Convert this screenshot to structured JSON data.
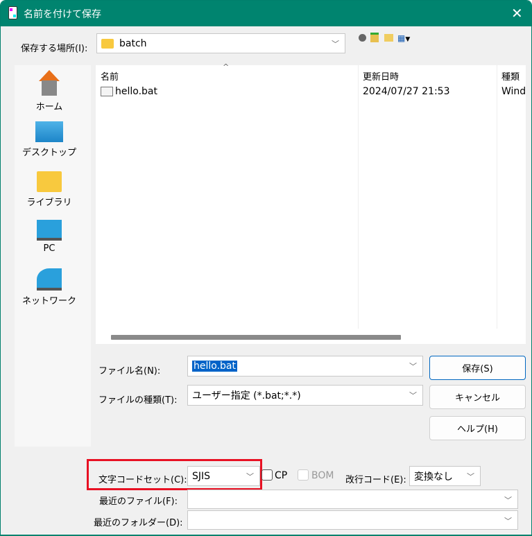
{
  "title": "名前を付けて保存",
  "location": {
    "label": "保存する場所(I):",
    "value": "batch"
  },
  "places": [
    {
      "label": "ホーム",
      "icon": "home-icon"
    },
    {
      "label": "デスクトップ",
      "icon": "desktop-icon"
    },
    {
      "label": "ライブラリ",
      "icon": "library-folder-icon"
    },
    {
      "label": "PC",
      "icon": "pc-icon"
    },
    {
      "label": "ネットワーク",
      "icon": "network-icon"
    }
  ],
  "columns": [
    "名前",
    "更新日時",
    "種類"
  ],
  "files": [
    {
      "name": "hello.bat",
      "modified": "2024/07/27 21:53",
      "type": "Wind"
    }
  ],
  "filename": {
    "label": "ファイル名(N):",
    "value": "hello.bat"
  },
  "filetype": {
    "label": "ファイルの種類(T):",
    "value": "ユーザー指定 (*.bat;*.*)"
  },
  "buttons": {
    "save": "保存(S)",
    "cancel": "キャンセル",
    "help": "ヘルプ(H)"
  },
  "encoding": {
    "label": "文字コードセット(C):",
    "value": "SJIS",
    "cp": "CP",
    "bom": "BOM",
    "newline_label": "改行コード(E):",
    "newline_value": "変換なし",
    "highlight_color": "#e81123"
  },
  "recent_files": {
    "label": "最近のファイル(F):",
    "value": ""
  },
  "recent_folders": {
    "label": "最近のフォルダー(D):",
    "value": ""
  }
}
